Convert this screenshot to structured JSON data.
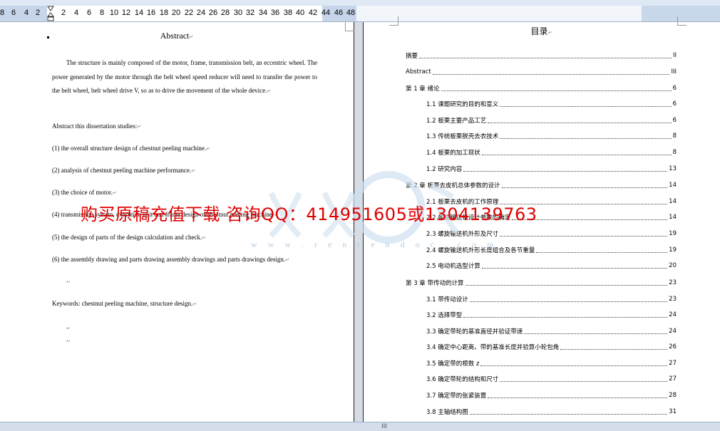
{
  "ruler": {
    "numbers": [
      "8",
      "6",
      "4",
      "2",
      "2",
      "4",
      "6",
      "8",
      "10",
      "12",
      "14",
      "16",
      "18",
      "20",
      "22",
      "24",
      "26",
      "28",
      "30",
      "32",
      "34",
      "36",
      "38",
      "40",
      "42",
      "44",
      "46",
      "48"
    ]
  },
  "left_page": {
    "title": "Abstract",
    "paragraph": "The structure is mainly composed of the motor, frame, transmission belt, an eccentric wheel. The power generated by the motor through the belt wheel speed reducer will need to transfer the power to the belt wheel, belt wheel drive V, so as to drive the movement of the whole device.",
    "lines": [
      "Abstract this dissertation studies:",
      "(1) the overall structure design of chestnut peeling machine.",
      "(2) analysis of chestnut peeling machine performance.",
      "(3) the choice of motor.",
      "(4) transmission system, execution unit and frame design of chestnut peeling machine",
      "(5) the design of parts of the design calculation and check.",
      "(6) the assembly drawing and parts drawing assembly drawings and parts drawings design."
    ],
    "keywords": "Keywords: chestnut peeling machine, structure design."
  },
  "right_page": {
    "title": "目录",
    "toc": [
      {
        "text": "摘要",
        "page": "II",
        "level": 0
      },
      {
        "text": "Abstract",
        "page": "III",
        "level": 0
      },
      {
        "text": "第 1 章  绪论",
        "page": "6",
        "level": 0
      },
      {
        "text": "1.1 课题研究的目的和意义",
        "page": "6",
        "level": 1
      },
      {
        "text": "1.2 板栗主要产品工艺",
        "page": "6",
        "level": 1
      },
      {
        "text": "1.3 传统板栗脱壳去衣技术",
        "page": "8",
        "level": 1
      },
      {
        "text": "1.4 板栗的加工现状",
        "page": "8",
        "level": 1
      },
      {
        "text": "1.2 研究内容",
        "page": "13",
        "level": 1
      },
      {
        "text": "第 2 章  板栗去皮机总体参数的设计",
        "page": "14",
        "level": 0
      },
      {
        "text": "2.1  板栗去皮机的工作原理",
        "page": "14",
        "level": 1
      },
      {
        "text": "2.2  螺旋输送机设计参数的确定",
        "page": "14",
        "level": 1
      },
      {
        "text": "2.3  螺旋输送机外形及尺寸",
        "page": "19",
        "level": 1
      },
      {
        "text": "2.4  螺旋输送机外形长度组合及各节重量",
        "page": "19",
        "level": 1
      },
      {
        "text": "2.5 电动机选型计算",
        "page": "20",
        "level": 1
      },
      {
        "text": "第 3 章  带传动的计算",
        "page": "23",
        "level": 0
      },
      {
        "text": "3.1 带传动设计",
        "page": "23",
        "level": 1
      },
      {
        "text": "3.2 选择带型",
        "page": "24",
        "level": 1
      },
      {
        "text": "3.3 确定带轮的基准直径并验证带速",
        "page": "24",
        "level": 1
      },
      {
        "text": "3.4 确定中心距离、带的基准长度并验算小轮包角",
        "page": "26",
        "level": 1
      },
      {
        "text": "3.5 确定带的根数 z",
        "page": "27",
        "level": 1
      },
      {
        "text": "3.6 确定带轮的结构和尺寸",
        "page": "27",
        "level": 1
      },
      {
        "text": "3.7 确定带的张紧装置",
        "page": "28",
        "level": 1
      },
      {
        "text": "3.8 主轴结构图",
        "page": "31",
        "level": 1
      }
    ]
  },
  "watermark": {
    "text": "购买原稿充值下载  咨询QQ：414951605或1304139763",
    "url": "w w w . r e n r e n d o c . c o m",
    "color": "#e00000"
  },
  "status": {
    "splitter": "III"
  }
}
